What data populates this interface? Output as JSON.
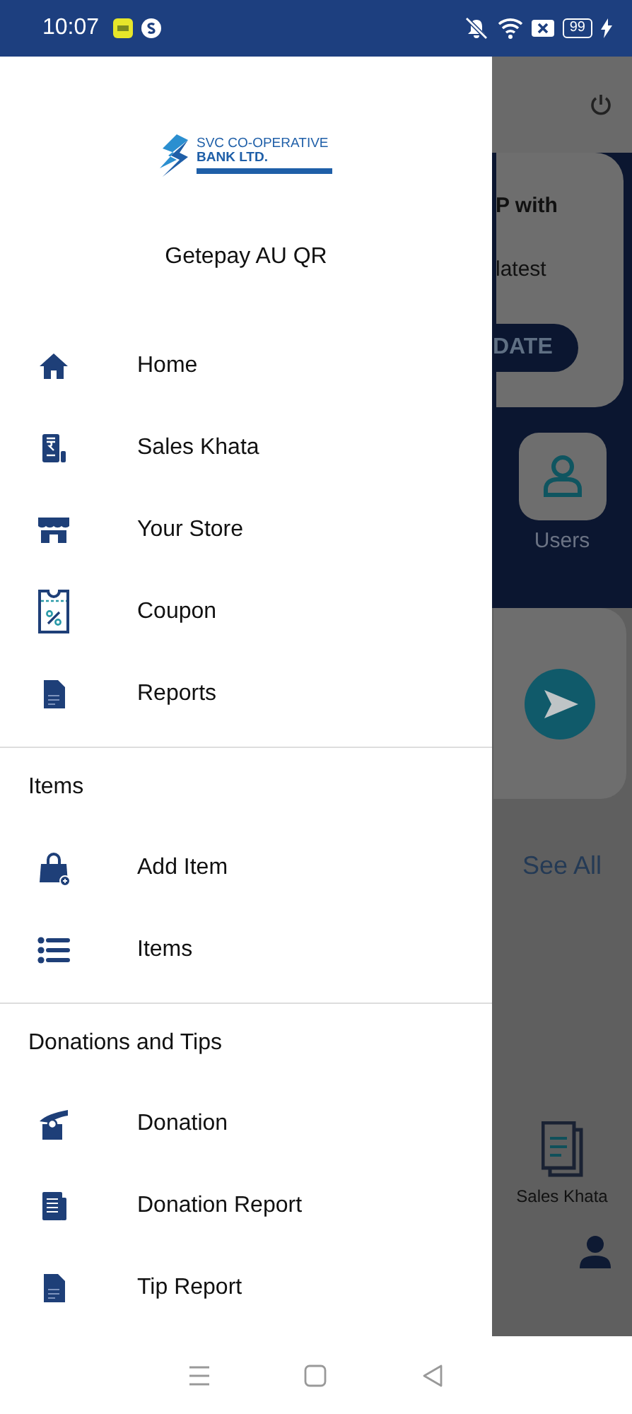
{
  "status_bar": {
    "time": "10:07",
    "battery": "99"
  },
  "drawer": {
    "logo": {
      "line_1": "SVC CO-OPERATIVE",
      "line_2": "BANK LTD."
    },
    "merchant_name": "Getepay AU QR",
    "sections": [
      {
        "items": [
          {
            "label": "Home",
            "kind": "home"
          },
          {
            "label": "Sales Khata",
            "kind": "khata"
          },
          {
            "label": "Your Store",
            "kind": "store"
          },
          {
            "label": "Coupon",
            "kind": "coupon"
          },
          {
            "label": "Reports",
            "kind": "report"
          }
        ]
      },
      {
        "title": "Items",
        "items": [
          {
            "label": "Add Item",
            "kind": "bag"
          },
          {
            "label": "Items",
            "kind": "list"
          }
        ]
      },
      {
        "title": "Donations and Tips",
        "items": [
          {
            "label": "Donation",
            "kind": "donation"
          },
          {
            "label": "Donation Report",
            "kind": "docs"
          },
          {
            "label": "Tip Report",
            "kind": "report"
          }
        ]
      }
    ]
  },
  "background": {
    "card_text_1": "P with",
    "card_text_2": "latest",
    "card_button": "DATE",
    "tile_label": "Users",
    "link": "See All",
    "shortcut_label": "Sales Khata"
  }
}
